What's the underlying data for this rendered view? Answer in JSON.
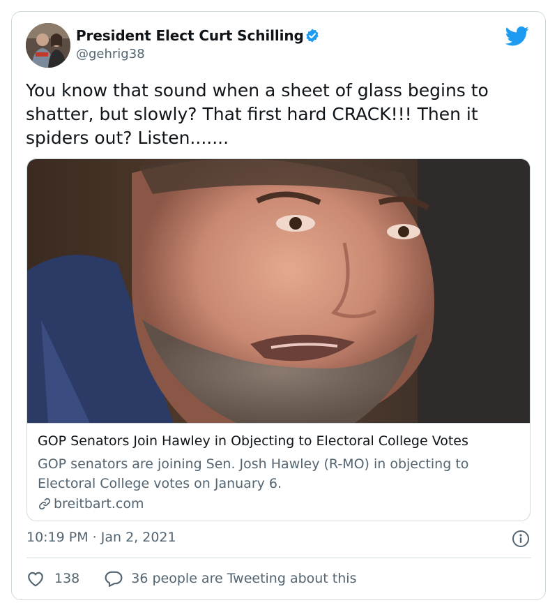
{
  "author": {
    "display_name": "President Elect Curt Schilling",
    "handle": "@gehrig38"
  },
  "tweet": {
    "text": "You know that sound when a sheet of glass begins to shatter, but slowly? That first hard CRACK!!! Then it spiders out? Listen......."
  },
  "link_card": {
    "title": "GOP Senators Join Hawley in Objecting to Electoral College Votes",
    "description": "GOP senators are joining Sen. Josh Hawley (R-MO) in objecting to Electoral College votes on January 6.",
    "domain": "breitbart.com"
  },
  "meta": {
    "timestamp": "10:19 PM · Jan 2, 2021"
  },
  "actions": {
    "like_count": "138",
    "discussion": "36 people are Tweeting about this"
  },
  "colors": {
    "text_primary": "#0f1419",
    "text_secondary": "#536471",
    "border": "#cfd9de",
    "brand_blue": "#1d9bf0"
  },
  "icons": [
    "verified-badge-icon",
    "twitter-bird-icon",
    "link-icon",
    "info-icon",
    "heart-icon",
    "reply-icon"
  ]
}
